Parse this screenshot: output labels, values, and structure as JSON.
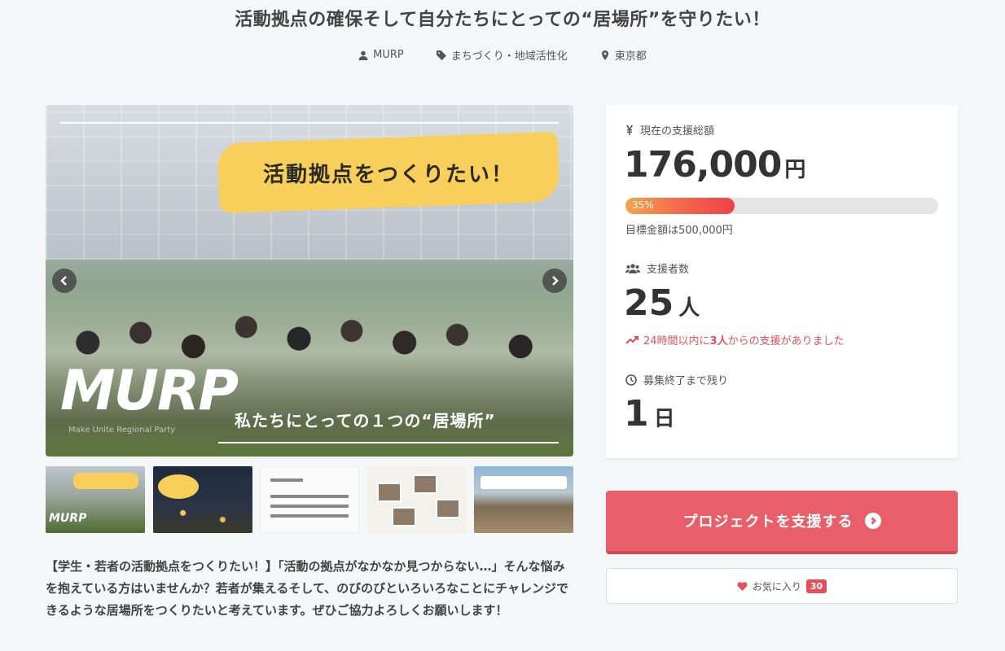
{
  "project": {
    "title": "活動拠点の確保そして自分たちにとっての“居場所”を守りたい！",
    "owner": "MURP",
    "category": "まちづくり・地域活性化",
    "location": "東京都"
  },
  "hero": {
    "banner_text": "活動拠点をつくりたい！",
    "logo_text": "MURP",
    "logo_subtext": "Make Unite Regional Party",
    "caption_text": "私たちにとっての１つの“居場所”"
  },
  "description": "【学生・若者の活動拠点をつくりたい！】「活動の拠点がなかなか見つからない…」そんな悩みを抱えている方はいませんか？若者が集えるそして、のびのびといろいろなことにチャレンジできるような居場所をつくりたいと考えています。ぜひご協力よろしくお願いします！",
  "stats": {
    "total_label": "現在の支援総額",
    "total_amount": "176,000",
    "currency_unit": "円",
    "progress_percent": 35,
    "progress_label": "35%",
    "goal_text": "目標金額は500,000円",
    "backers_label": "支援者数",
    "backers_count": "25",
    "backers_unit": "人",
    "trend_prefix": "24時間以内に",
    "trend_count": "3人",
    "trend_suffix": "からの支援がありました",
    "remaining_label": "募集終了まで残り",
    "remaining_count": "1",
    "remaining_unit": "日"
  },
  "actions": {
    "support_label": "プロジェクトを支援する",
    "favorite_label": "お気に入り",
    "favorite_count": "30"
  },
  "colors": {
    "accent": "#e85f69",
    "progress_start": "#f5a44a",
    "progress_end": "#ef4149",
    "banner_yellow": "#f7cf5a"
  }
}
